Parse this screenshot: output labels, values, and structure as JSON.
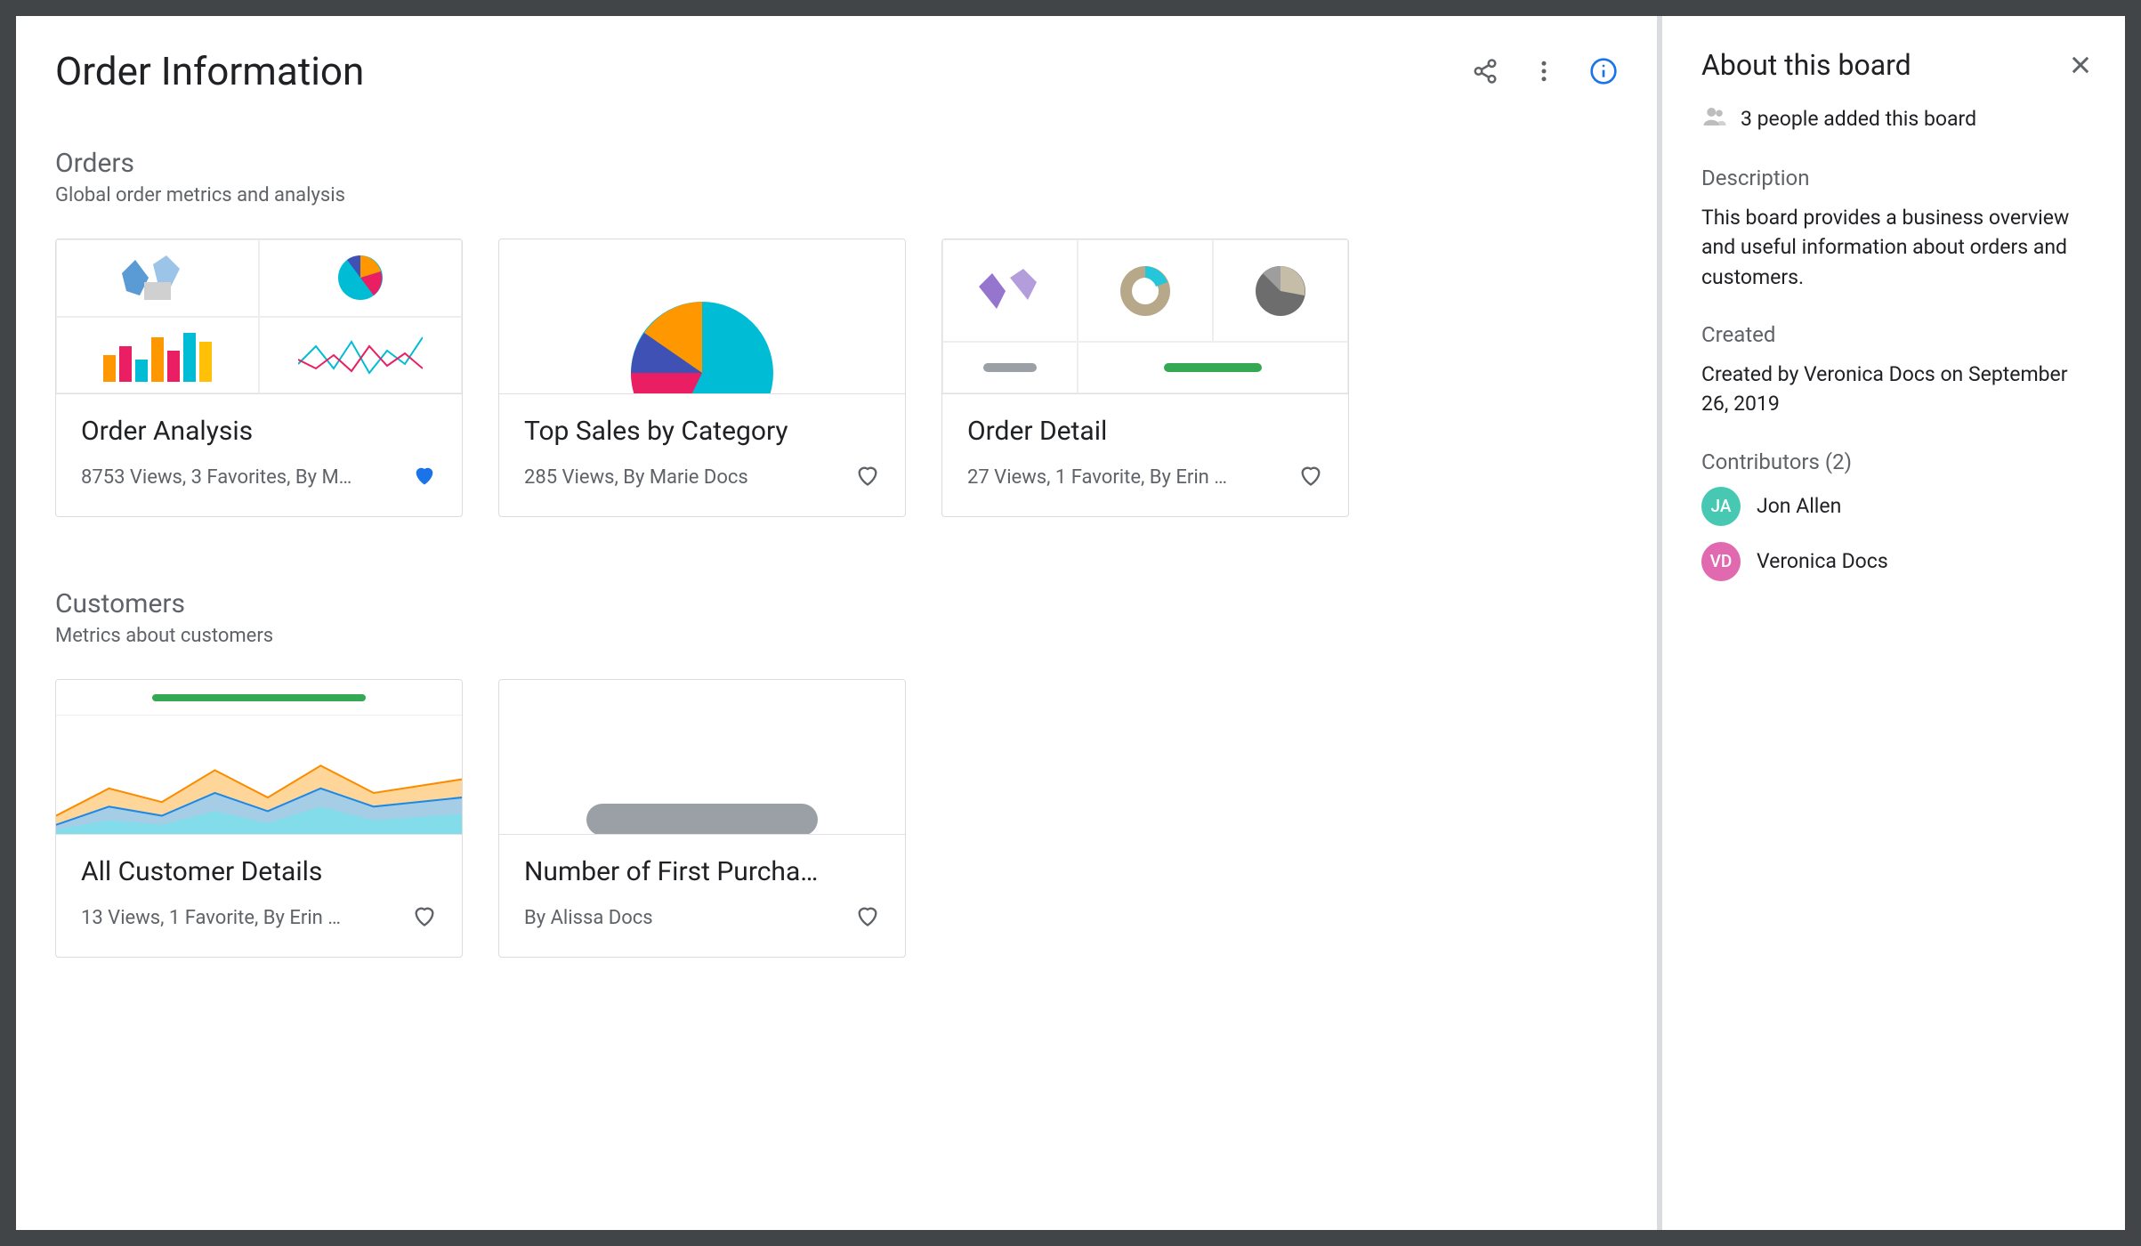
{
  "page_title": "Order Information",
  "sections": [
    {
      "title": "Orders",
      "subtitle": "Global order metrics and analysis",
      "cards": [
        {
          "title": "Order Analysis",
          "meta": "8753 Views, 3 Favorites, By M…",
          "favorited": true
        },
        {
          "title": "Top Sales by Category",
          "meta": "285 Views, By Marie Docs",
          "favorited": false
        },
        {
          "title": "Order Detail",
          "meta": "27 Views, 1 Favorite, By Erin …",
          "favorited": false
        }
      ]
    },
    {
      "title": "Customers",
      "subtitle": "Metrics about customers",
      "cards": [
        {
          "title": "All Customer Details",
          "meta": "13 Views, 1 Favorite, By Erin …",
          "favorited": false
        },
        {
          "title": "Number of First Purcha…",
          "meta": "By Alissa Docs",
          "favorited": false
        }
      ]
    }
  ],
  "sidebar": {
    "title": "About this board",
    "added_text": "3 people added this board",
    "description_label": "Description",
    "description": "This board provides a business overview and useful information about orders and customers.",
    "created_label": "Created",
    "created": "Created by Veronica Docs on September 26, 2019",
    "contributors_label": "Contributors (2)",
    "contributors": [
      {
        "initials": "JA",
        "name": "Jon Allen",
        "color": "#46c8b3"
      },
      {
        "initials": "VD",
        "name": "Veronica Docs",
        "color": "#e069b0"
      }
    ]
  },
  "colors": {
    "blue": "#1a73e8",
    "pink": "#e91e63",
    "cyan": "#00bcd4",
    "orange": "#ff9800",
    "green": "#34a853",
    "gray": "#9aa0a6",
    "purple": "#9575cd",
    "tan": "#b8a88a",
    "darkgray": "#6d6d6d"
  }
}
